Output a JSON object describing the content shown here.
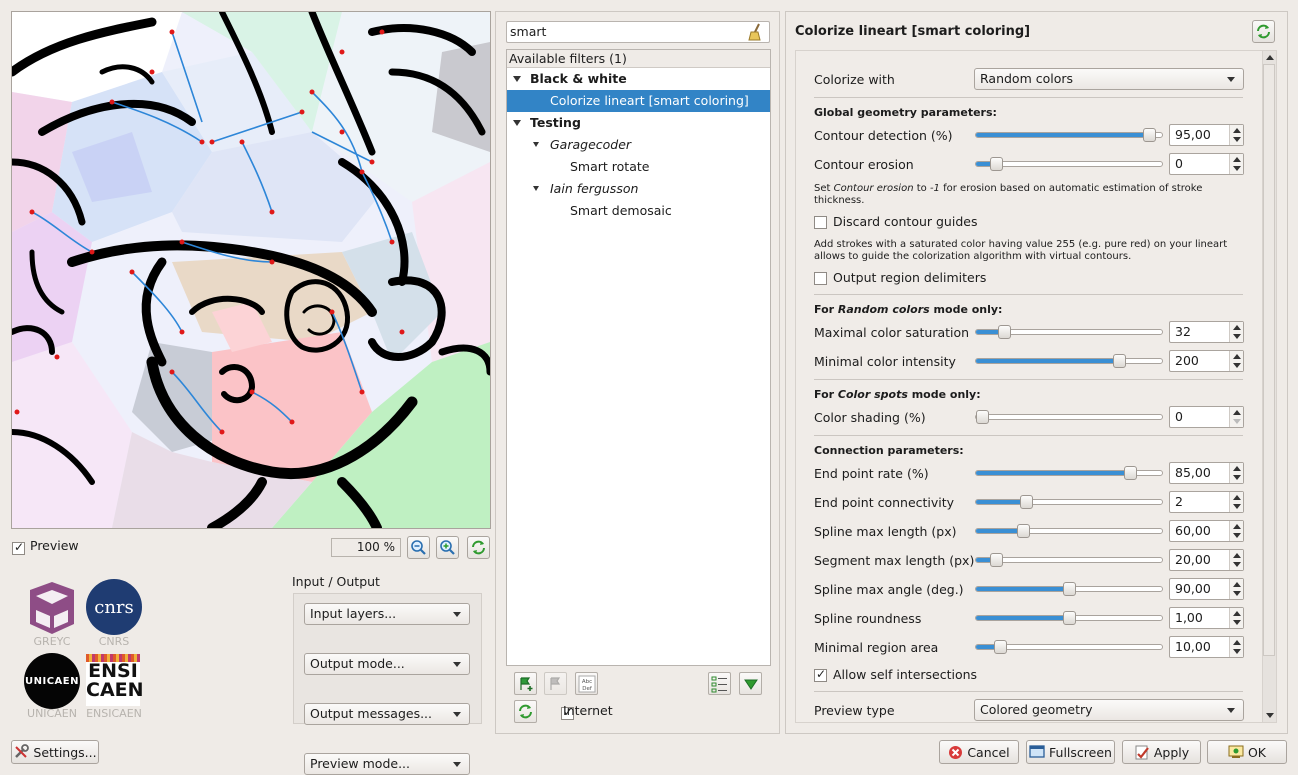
{
  "preview": {
    "checkbox_label": "Preview",
    "zoom": "100 %"
  },
  "logos": {
    "greyc": "GREYC",
    "cnrs": "CNRS",
    "cnrs_mark": "cnrs",
    "unicaen": "UNICAEN",
    "unicaen_mark": "UNICAEN",
    "ensicaen": "ENSICAEN",
    "ensicaen_mark_1": "ENSI",
    "ensicaen_mark_2": "CAEN"
  },
  "io": {
    "title": "Input / Output",
    "input_layers": "Input layers...",
    "output_mode": "Output mode...",
    "output_messages": "Output messages...",
    "preview_mode": "Preview mode..."
  },
  "settings_label": "Settings...",
  "filters": {
    "search_value": "smart",
    "header": "Available filters (1)",
    "tree": [
      {
        "label": "Black & white",
        "kind": "category"
      },
      {
        "label": "Colorize lineart [smart coloring]",
        "kind": "filter-selected"
      },
      {
        "label": "Testing",
        "kind": "category"
      },
      {
        "label": "Garagecoder",
        "kind": "author"
      },
      {
        "label": "Smart rotate",
        "kind": "filter"
      },
      {
        "label": "Iain fergusson",
        "kind": "author"
      },
      {
        "label": "Smart demosaic",
        "kind": "filter"
      }
    ],
    "internet_label": "Internet",
    "abc_icon_text_1": "Abc",
    "abc_icon_text_2": "Def"
  },
  "params": {
    "title": "Colorize lineart [smart coloring]",
    "colorize_with_label": "Colorize with",
    "colorize_with_value": "Random colors",
    "global_header": "Global geometry parameters:",
    "contour_detection": {
      "label": "Contour detection (%)",
      "value": "95,00",
      "fraction": 0.93
    },
    "contour_erosion": {
      "label": "Contour erosion",
      "value": "0",
      "fraction": 0.11
    },
    "erosion_help_prefix": "Set ",
    "erosion_help_italic": "Contour erosion",
    "erosion_help_mid": " to ",
    "erosion_help_value": "-1",
    "erosion_help_suffix": " for erosion based on automatic estimation of stroke thickness.",
    "discard_guides": "Discard contour guides",
    "guides_help": "Add strokes with a saturated color having value 255 (e.g. pure red) on your lineart allows to guide the colorization algorithm with virtual contours.",
    "output_delimiters": "Output region delimiters",
    "random_header_prefix": "For ",
    "random_header_italic": "Random colors",
    "random_header_suffix": " mode only:",
    "max_saturation": {
      "label": "Maximal color saturation",
      "value": "32",
      "fraction": 0.15
    },
    "min_intensity": {
      "label": "Minimal color intensity",
      "value": "200",
      "fraction": 0.77
    },
    "spots_header_prefix": "For ",
    "spots_header_italic": "Color spots",
    "spots_header_suffix": " mode only:",
    "color_shading": {
      "label": "Color shading (%)",
      "value": "0",
      "fraction": 0.03
    },
    "connection_header": "Connection parameters:",
    "end_point_rate": {
      "label": "End point rate (%)",
      "value": "85,00",
      "fraction": 0.83
    },
    "end_point_connectivity": {
      "label": "End point connectivity",
      "value": "2",
      "fraction": 0.27
    },
    "spline_max_length": {
      "label": "Spline max length (px)",
      "value": "60,00",
      "fraction": 0.25
    },
    "segment_max_length": {
      "label": "Segment max length (px)",
      "value": "20,00",
      "fraction": 0.11
    },
    "spline_max_angle": {
      "label": "Spline max angle (deg.)",
      "value": "90,00",
      "fraction": 0.5
    },
    "spline_roundness": {
      "label": "Spline roundness",
      "value": "1,00",
      "fraction": 0.5
    },
    "min_region_area": {
      "label": "Minimal region area",
      "value": "10,00",
      "fraction": 0.13
    },
    "allow_self_intersections": "Allow self intersections",
    "preview_type_label": "Preview type",
    "preview_type_value": "Colored geometry"
  },
  "buttons": {
    "cancel": "Cancel",
    "fullscreen": "Fullscreen",
    "apply": "Apply",
    "ok": "OK"
  },
  "colors": {
    "selection": "#3284c6",
    "slider_fill": "#3a8fd4",
    "window_bg": "#efebe7"
  }
}
